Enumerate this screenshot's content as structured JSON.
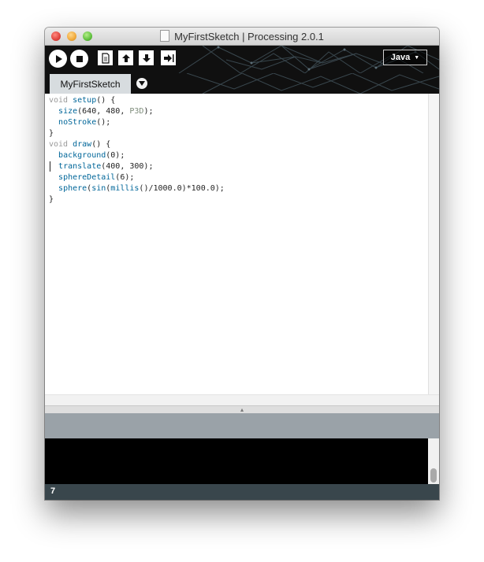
{
  "window": {
    "title": "MyFirstSketch | Processing 2.0.1"
  },
  "toolbar": {
    "run_icon": "play-icon",
    "stop_icon": "stop-icon",
    "new_icon": "new-document-icon",
    "open_icon": "open-arrow-up-icon",
    "save_icon": "save-arrow-down-icon",
    "export_icon": "export-arrow-icon",
    "mode_label": "Java",
    "mode_arrow": "▼"
  },
  "tabs": {
    "items": [
      {
        "label": "MyFirstSketch"
      }
    ],
    "menu_icon": "chevron-down-icon"
  },
  "editor": {
    "lines": [
      [
        {
          "t": "void ",
          "c": "k"
        },
        {
          "t": "setup",
          "c": "f"
        },
        {
          "t": "() {",
          "c": "p"
        }
      ],
      [
        {
          "t": "  ",
          "c": "p"
        },
        {
          "t": "size",
          "c": "f"
        },
        {
          "t": "(640, 480, ",
          "c": "p"
        },
        {
          "t": "P3D",
          "c": "c"
        },
        {
          "t": ");",
          "c": "p"
        }
      ],
      [
        {
          "t": "  ",
          "c": "p"
        },
        {
          "t": "noStroke",
          "c": "f"
        },
        {
          "t": "();",
          "c": "p"
        }
      ],
      [
        {
          "t": "}",
          "c": "p"
        }
      ],
      [
        {
          "t": "void ",
          "c": "k"
        },
        {
          "t": "draw",
          "c": "f"
        },
        {
          "t": "() {",
          "c": "p"
        }
      ],
      [
        {
          "t": "  ",
          "c": "p"
        },
        {
          "t": "background",
          "c": "f"
        },
        {
          "t": "(0);",
          "c": "p"
        }
      ],
      [
        {
          "t": "  ",
          "c": "p"
        },
        {
          "t": "translate",
          "c": "f"
        },
        {
          "t": "(400, 300);",
          "c": "p"
        }
      ],
      [
        {
          "t": "  ",
          "c": "p"
        },
        {
          "t": "sphereDetail",
          "c": "f"
        },
        {
          "t": "(6);",
          "c": "p"
        }
      ],
      [
        {
          "t": "  ",
          "c": "p"
        },
        {
          "t": "sphere",
          "c": "f"
        },
        {
          "t": "(",
          "c": "p"
        },
        {
          "t": "sin",
          "c": "f"
        },
        {
          "t": "(",
          "c": "p"
        },
        {
          "t": "millis",
          "c": "f"
        },
        {
          "t": "()/1000.0)*100.0);",
          "c": "p"
        }
      ],
      [
        {
          "t": "}",
          "c": "p"
        }
      ]
    ]
  },
  "status": {
    "current_line": "7"
  },
  "colors": {
    "keyword": "#999999",
    "function": "#006699",
    "constant": "#7d8c7a",
    "toolbar_bg": "#101010",
    "status_bg": "#9aa2a8",
    "line_bar_bg": "#39464c"
  }
}
